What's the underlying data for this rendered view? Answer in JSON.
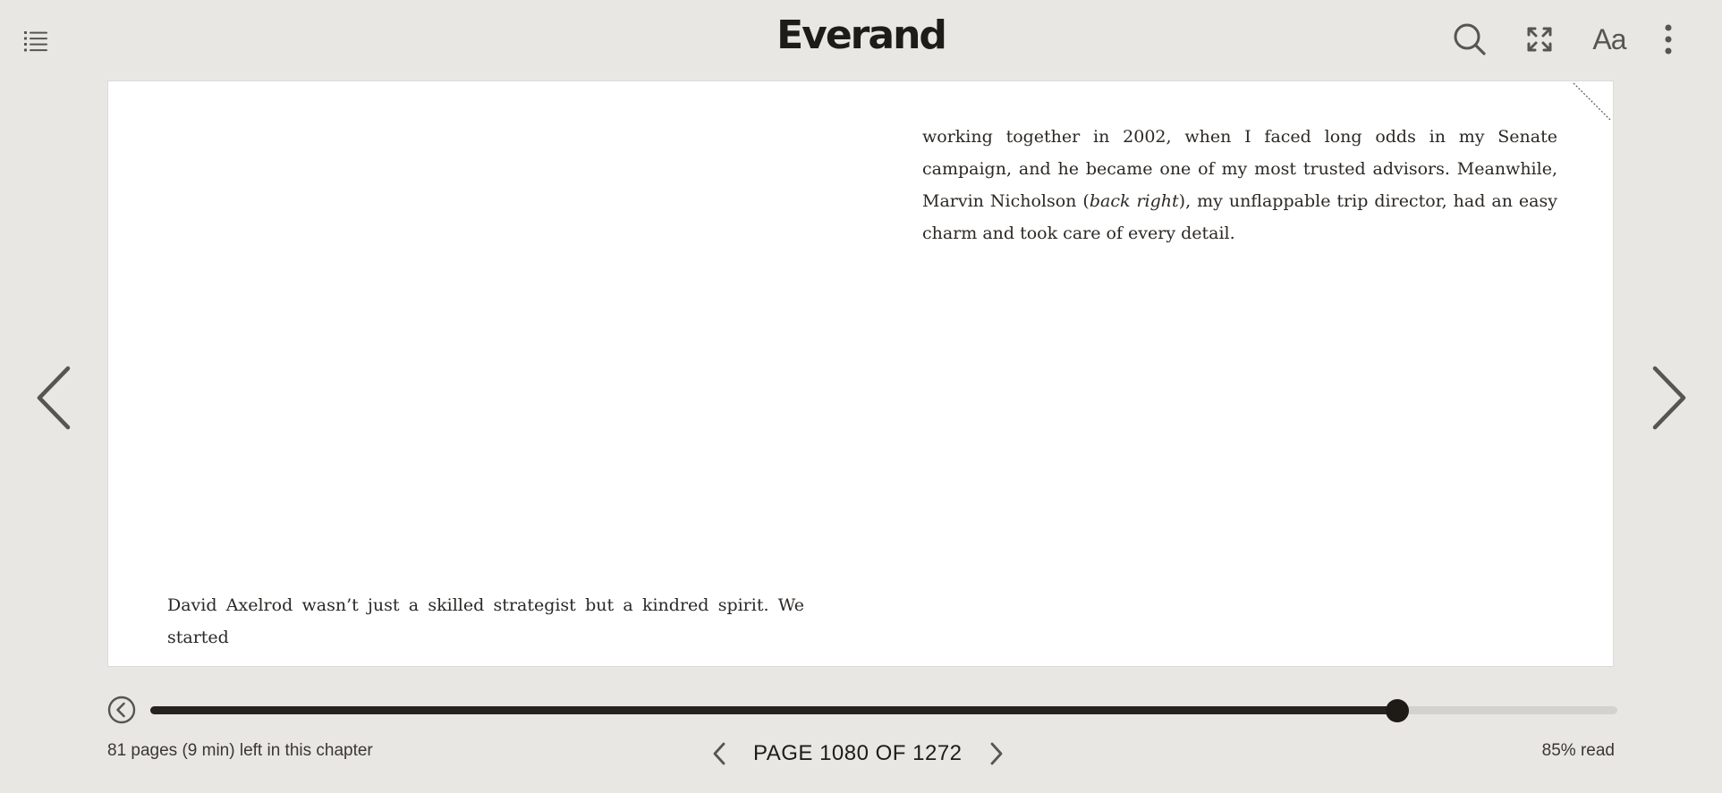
{
  "header": {
    "logo": "Everand",
    "toc_icon": "list-icon",
    "search_icon": "search-icon",
    "fullscreen_icon": "expand-icon",
    "font_settings_label": "Aa",
    "more_icon": "more-vertical-icon"
  },
  "page": {
    "right_column": {
      "segment_1": "working together in 2002, when I faced long odds in my Senate campaign, and he became one of my most trusted advisors. Meanwhile, Marvin Nicholson (",
      "italic": "back right",
      "segment_2": "), my unflappable trip director, had an easy charm and took care of every detail."
    },
    "left_column_last_line": "David Axelrod wasn’t just a skilled strategist but a kindred spirit. We started"
  },
  "navigation": {
    "prev_icon": "chevron-left-icon",
    "next_icon": "chevron-right-icon"
  },
  "progress": {
    "back_icon": "history-back-icon",
    "percent_complete": 85
  },
  "footer": {
    "chapter_remaining": "81 pages (9 min) left in this chapter",
    "page_label": "PAGE 1080 OF 1272",
    "read_status": "85% read"
  },
  "colors": {
    "background": "#e9e7e4",
    "page": "#ffffff",
    "progress_fill": "#26221d",
    "progress_track": "#d4d2cf"
  }
}
